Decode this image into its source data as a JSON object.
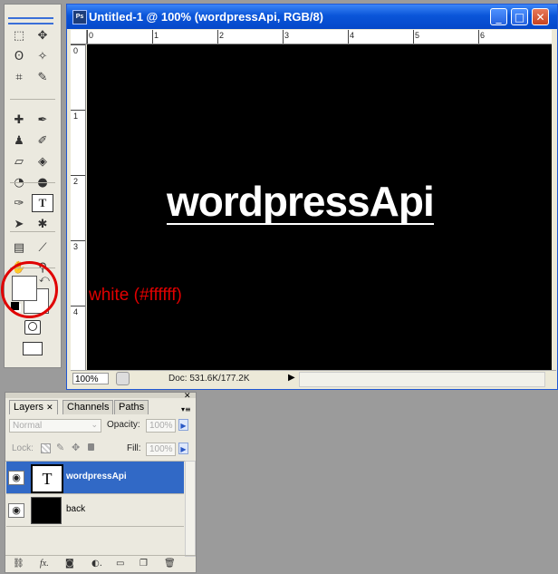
{
  "toolbox": {
    "tools": [
      {
        "name": "marquee-tool-icon",
        "glyph": "⬚"
      },
      {
        "name": "move-tool-icon",
        "glyph": "✥"
      },
      {
        "name": "lasso-tool-icon",
        "glyph": "ʘ"
      },
      {
        "name": "magic-wand-tool-icon",
        "glyph": "✧"
      },
      {
        "name": "crop-tool-icon",
        "glyph": "⌗"
      },
      {
        "name": "slice-tool-icon",
        "glyph": "✎"
      },
      {
        "name": "healing-brush-tool-icon",
        "glyph": "✚"
      },
      {
        "name": "brush-tool-icon",
        "glyph": "✒"
      },
      {
        "name": "clone-stamp-tool-icon",
        "glyph": "♟"
      },
      {
        "name": "history-brush-tool-icon",
        "glyph": "✐"
      },
      {
        "name": "eraser-tool-icon",
        "glyph": "▱"
      },
      {
        "name": "paint-bucket-tool-icon",
        "glyph": "◈"
      },
      {
        "name": "blur-tool-icon",
        "glyph": "◔"
      },
      {
        "name": "dodge-tool-icon",
        "glyph": "●"
      },
      {
        "name": "pen-tool-icon",
        "glyph": "✑"
      },
      {
        "name": "type-tool-icon",
        "glyph": "T"
      },
      {
        "name": "path-selection-tool-icon",
        "glyph": "➤"
      },
      {
        "name": "custom-shape-tool-icon",
        "glyph": "✱"
      },
      {
        "name": "notes-tool-icon",
        "glyph": "▤"
      },
      {
        "name": "eyedropper-tool-icon",
        "glyph": "⟋"
      },
      {
        "name": "hand-tool-icon",
        "glyph": "✋"
      },
      {
        "name": "zoom-tool-icon",
        "glyph": "⚲"
      }
    ],
    "foreground_color": "#ffffff",
    "background_color": "#ffffff"
  },
  "annotation": {
    "text": "white (#ffffff)",
    "color": "#e00000"
  },
  "document": {
    "title": "Untitled-1 @ 100% (wordpressApi, RGB/8)",
    "app_icon": "Ps",
    "minimize_glyph": "_",
    "maximize_glyph": "□",
    "close_glyph": "✕",
    "ruler_top": [
      "0",
      "1",
      "2",
      "3",
      "4",
      "5",
      "6"
    ],
    "ruler_left": [
      "0",
      "1",
      "2",
      "3",
      "4"
    ],
    "canvas_text": "wordpressApi",
    "canvas_bg": "#000000",
    "status": {
      "zoom": "100%",
      "doc_info": "Doc: 531.6K/177.2K",
      "arrow": "▶"
    }
  },
  "layers_panel": {
    "tabs": [
      {
        "label": "Layers",
        "close": "✕"
      },
      {
        "label": "Channels"
      },
      {
        "label": "Paths"
      }
    ],
    "blend_mode": "Normal",
    "opacity_label": "Opacity:",
    "opacity_value": "100%",
    "lock_label": "Lock:",
    "fill_label": "Fill:",
    "fill_value": "100%",
    "layers": [
      {
        "name": "wordpressApi",
        "thumb": "T",
        "selected": true
      },
      {
        "name": "back",
        "thumb": "",
        "selected": false
      }
    ],
    "bottom_icons": [
      "link-layers-icon",
      "layer-style-icon",
      "layer-mask-icon",
      "adjustment-layer-icon",
      "new-group-icon",
      "new-layer-icon",
      "delete-layer-icon"
    ]
  },
  "colors": {
    "selection": "#3169c6",
    "titlebar": "#0a55d9",
    "annotation": "#e00000"
  }
}
